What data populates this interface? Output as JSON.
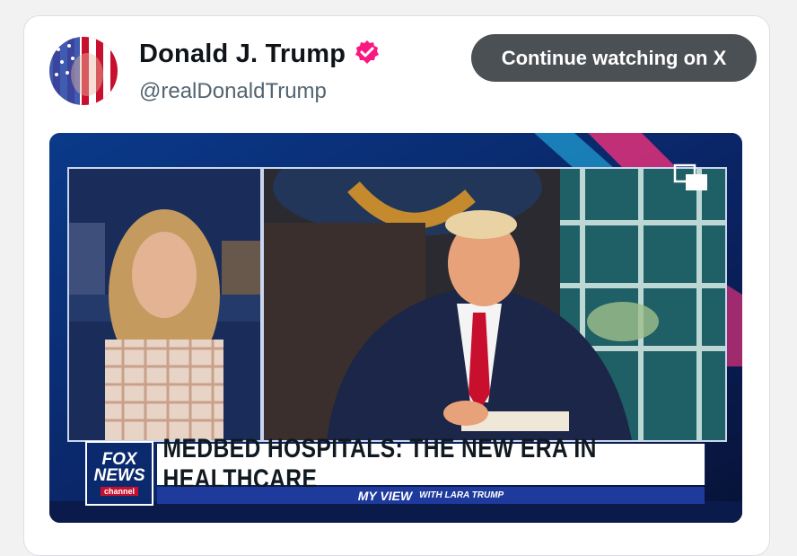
{
  "post": {
    "display_name": "Donald J. Trump",
    "handle": "@realDonaldTrump",
    "verified": true,
    "verified_color": "#f91880",
    "cta_label": "Continue watching on X"
  },
  "video": {
    "network_logo": {
      "line1": "FOX",
      "line2": "NEWS",
      "line3": "channel"
    },
    "headline": "MEDBED HOSPITALS: THE NEW ERA IN HEALTHCARE",
    "show_bar": {
      "show": "MY VIEW",
      "with": "WITH LARA TRUMP"
    },
    "icons": [
      "verified-badge-icon",
      "picture-in-picture-icon"
    ]
  }
}
